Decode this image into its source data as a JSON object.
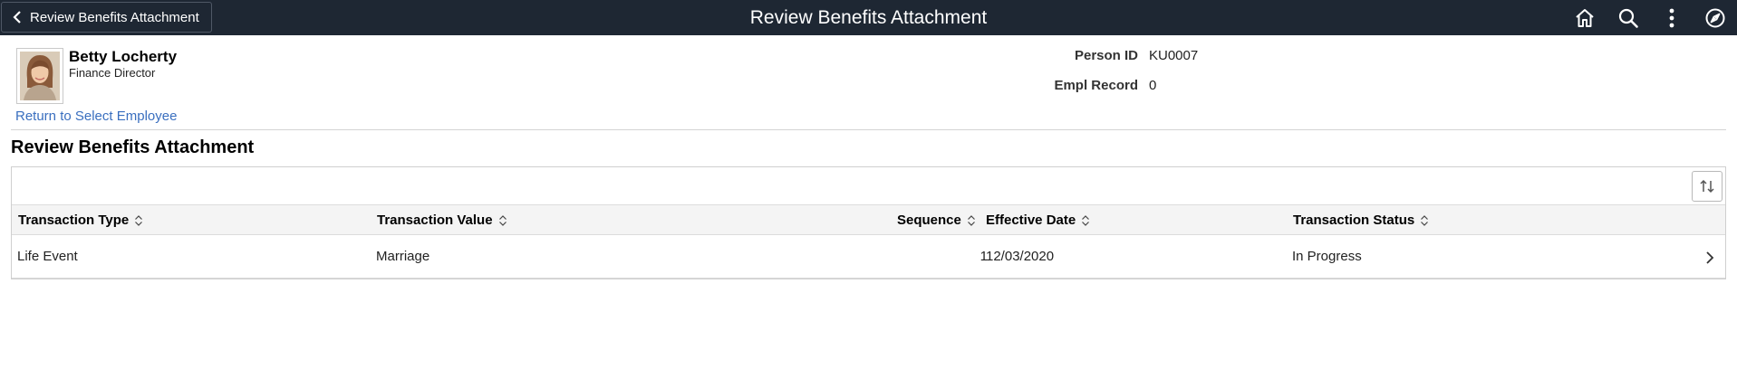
{
  "banner": {
    "back_label": "Review Benefits Attachment",
    "title": "Review Benefits Attachment",
    "bg_color": "#1e2733",
    "icons": [
      "home-icon",
      "search-icon",
      "more-options-icon",
      "navigator-icon"
    ]
  },
  "employee": {
    "name": "Betty Locherty",
    "job_title": "Finance Director",
    "return_link": "Return to Select Employee",
    "person_id_label": "Person ID",
    "person_id": "KU0007",
    "empl_record_label": "Empl Record",
    "empl_record": "0"
  },
  "section": {
    "title": "Review Benefits Attachment"
  },
  "grid": {
    "columns": [
      "Transaction Type",
      "Transaction Value",
      "Sequence",
      "Effective Date",
      "Transaction Status"
    ],
    "rows": [
      {
        "transaction_type": "Life Event",
        "transaction_value": "Marriage",
        "sequence": "1",
        "effective_date": "12/03/2020",
        "transaction_status": "In Progress"
      }
    ]
  },
  "colors": {
    "link": "#3a6fbf",
    "header_bg": "#f4f4f4"
  }
}
